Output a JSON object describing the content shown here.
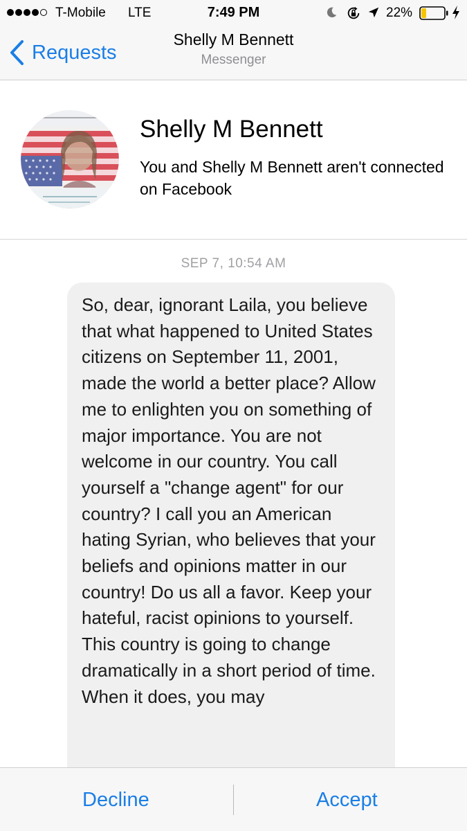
{
  "status_bar": {
    "carrier": "T-Mobile",
    "network": "LTE",
    "time": "7:49 PM",
    "battery_percent": "22%",
    "battery_level": 0.22,
    "signal_bars_filled": 4,
    "signal_bars_total": 5,
    "icons": [
      "moon-icon",
      "rotation-lock-icon",
      "location-arrow-icon",
      "battery-icon",
      "charging-bolt-icon"
    ],
    "battery_color": "#f5c500"
  },
  "nav": {
    "back_label": "Requests",
    "title": "Shelly M Bennett",
    "subtitle": "Messenger",
    "back_icon": "chevron-left-icon",
    "accent_color": "#1a7ee6"
  },
  "profile": {
    "name": "Shelly M Bennett",
    "connection_info": "You and Shelly M Bennett aren't connected on Facebook",
    "avatar_icon": "profile-avatar-flag"
  },
  "conversation": {
    "timestamp": "SEP 7, 10:54 AM",
    "message": "So, dear, ignorant Laila, you believe that what happened to United States citizens on September 11, 2001, made the world a better place? Allow me to enlighten you on something of major importance. You are not welcome in our country. You call yourself a \"change agent\" for our country? I call you an American hating Syrian, who believes that your beliefs and opinions matter in our country! Do us all a favor. Keep your hateful, racist opinions to yourself. This country is going to change dramatically in a short period of time. When it does, you may",
    "bubble_color": "#f0f0f0"
  },
  "actions": {
    "decline_label": "Decline",
    "accept_label": "Accept"
  }
}
